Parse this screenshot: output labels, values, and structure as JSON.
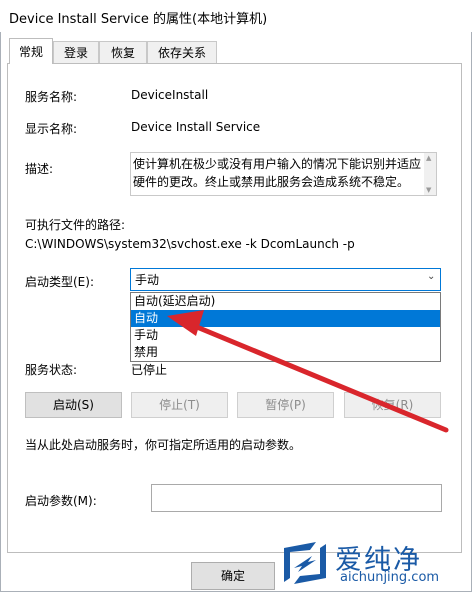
{
  "window": {
    "title": "Device Install Service 的属性(本地计算机)"
  },
  "tabs": [
    {
      "label": "常规",
      "active": true
    },
    {
      "label": "登录",
      "active": false
    },
    {
      "label": "恢复",
      "active": false
    },
    {
      "label": "依存关系",
      "active": false
    }
  ],
  "general": {
    "service_name_label": "服务名称:",
    "service_name_value": "DeviceInstall",
    "display_name_label": "显示名称:",
    "display_name_value": "Device Install Service",
    "description_label": "描述:",
    "description_value": "使计算机在极少或没有用户输入的情况下能识别并适应硬件的更改。终止或禁用此服务会造成系统不稳定。",
    "exec_path_label": "可执行文件的路径:",
    "exec_path_value": "C:\\WINDOWS\\system32\\svchost.exe -k DcomLaunch -p",
    "startup_type_label": "启动类型(E):",
    "startup_type_value": "手动",
    "startup_options": [
      "自动(延迟启动)",
      "自动",
      "手动",
      "禁用"
    ],
    "startup_highlighted": "自动",
    "status_label": "服务状态:",
    "status_value": "已停止",
    "buttons": {
      "start": "启动(S)",
      "stop": "停止(T)",
      "pause": "暂停(P)",
      "resume": "恢复(R)"
    },
    "hint_text": "当从此处启动服务时，你可指定所适用的启动参数。",
    "param_label": "启动参数(M):",
    "param_value": ""
  },
  "footer": {
    "ok": "确定"
  },
  "watermark": {
    "brand": "爱纯净",
    "url": "aichunjing.com"
  },
  "colors": {
    "accent": "#0078d7",
    "arrow": "#d9262c",
    "watermark": "#1a5aa6"
  }
}
